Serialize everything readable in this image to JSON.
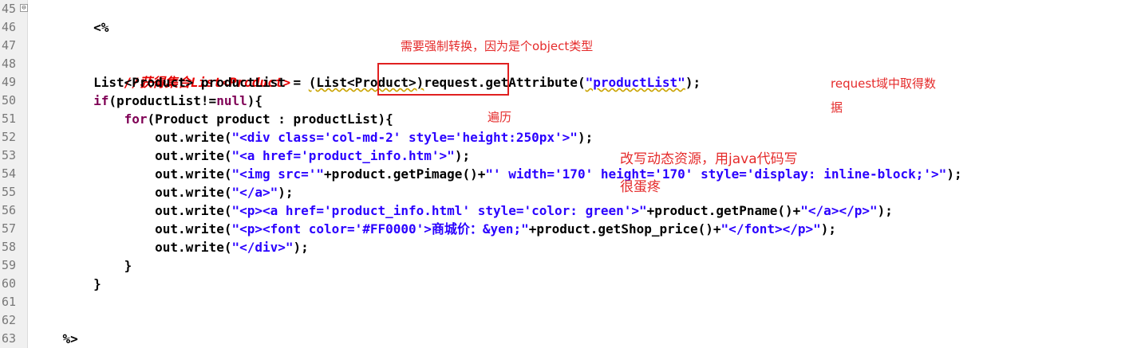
{
  "editor": {
    "line_numbers": [
      "45",
      "46",
      "47",
      "48",
      "49",
      "50",
      "51",
      "52",
      "53",
      "54",
      "55",
      "56",
      "57",
      "58",
      "59",
      "60",
      "61",
      "62",
      "63"
    ],
    "fold_marker": "⊖",
    "lines": {
      "l45": "    <%",
      "l48_comment": "        //获得集合List<Product>",
      "l49_a": "        List<Product> productList = ",
      "l49_cast": "(List<Product>)",
      "l49_b": "request.getAttribute(",
      "l49_str": "\"productList\"",
      "l49_c": ");",
      "l50_kw": "if",
      "l50_a": "(productList!=",
      "l50_null": "null",
      "l50_b": "){",
      "l51_kw": "for",
      "l51_a": "(Product product : productList){",
      "l52_a": "out.write(",
      "l52_str": "\"<div class='col-md-2' style='height:250px'>\"",
      "l52_b": ");",
      "l53_a": "out.write(",
      "l53_str": "\"<a href='product_info.htm'>\"",
      "l53_b": ");",
      "l54_a": "out.write(",
      "l54_str1": "\"<img src='\"",
      "l54_mid": "+product.getPimage()+",
      "l54_str2": "\"' width='170' height='170' style='display: inline-block;'>\"",
      "l54_b": ");",
      "l55_a": "out.write(",
      "l55_str": "\"</a>\"",
      "l55_b": ");",
      "l56_a": "out.write(",
      "l56_str1": "\"<p><a href='product_info.html' style='color: green'>\"",
      "l56_mid": "+product.getPname()+",
      "l56_str2": "\"</a></p>\"",
      "l56_b": ");",
      "l57_a": "out.write(",
      "l57_str1": "\"<p><font color='#FF0000'>商城价：&yen;\"",
      "l57_mid": "+product.getShop_price()+",
      "l57_str2": "\"</font></p>\"",
      "l57_b": ");",
      "l58_a": "out.write(",
      "l58_str": "\"</div>\"",
      "l58_b": ");",
      "l59": "}",
      "l60": "}",
      "l63": "%>"
    }
  },
  "annotations": {
    "cast_note": "需要强制转换，因为是个object类型",
    "request_note_1": "request域中取得数",
    "request_note_2": "据",
    "loop_note": "遍历",
    "dynamic_note_1": "改写动态资源，用java代码写",
    "dynamic_note_2": "很蛋疼"
  },
  "colors": {
    "keyword": "#7f0055",
    "string": "#2a00ff",
    "comment": "#e60000",
    "annotation": "#e52b2b",
    "highlight_box": "#e02020"
  }
}
